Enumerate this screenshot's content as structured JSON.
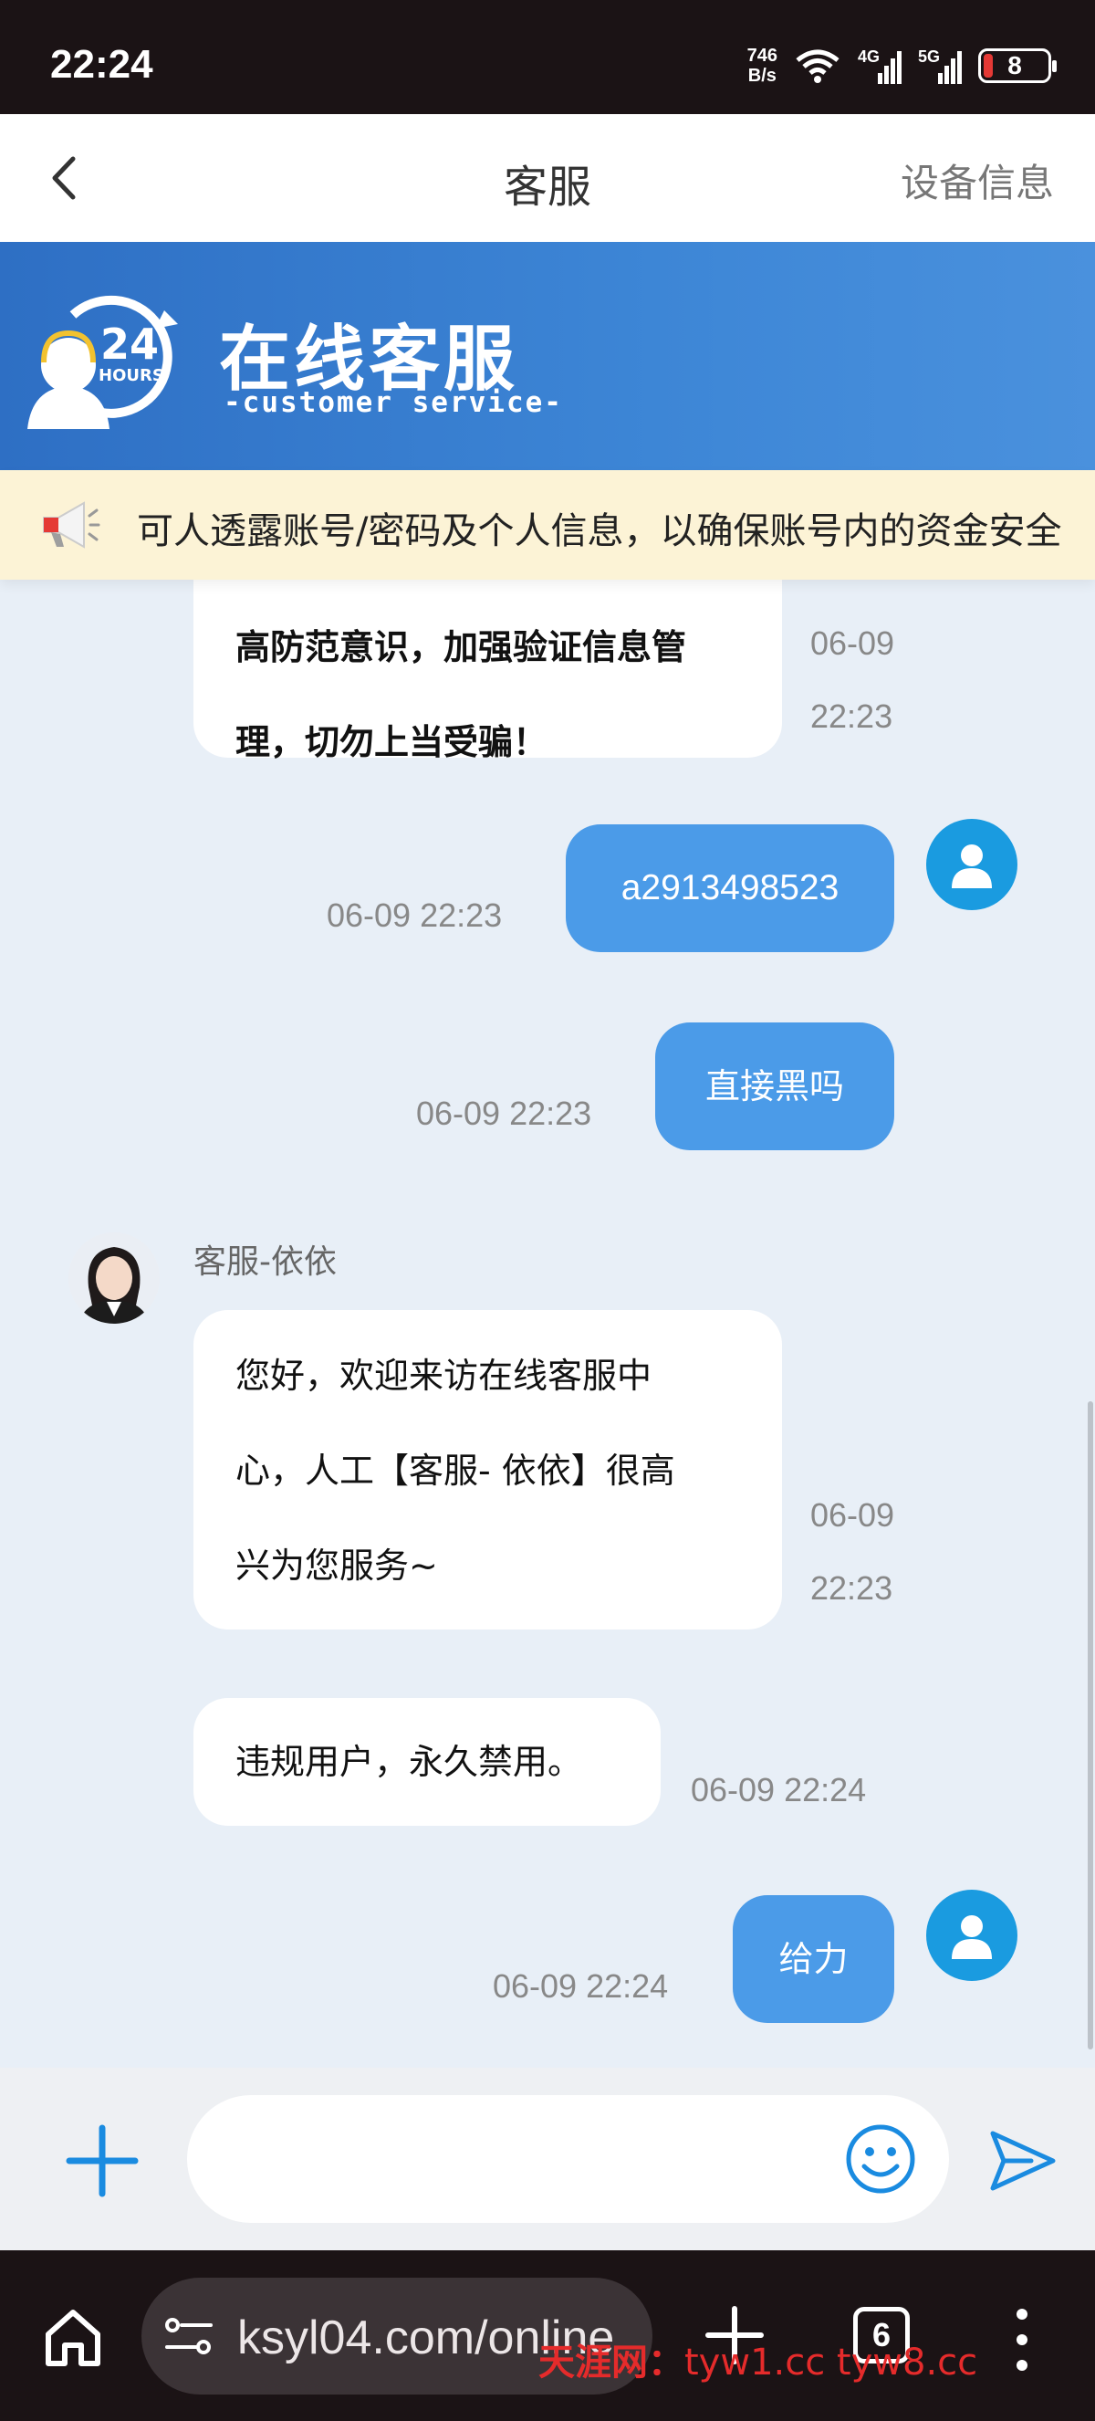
{
  "status_bar": {
    "time": "22:24",
    "net_speed_value": "746",
    "net_speed_unit": "B/s",
    "signal_1_tag": "4G",
    "signal_2_tag": "5G",
    "battery": "8"
  },
  "nav": {
    "title": "客服",
    "right_link": "设备信息"
  },
  "banner": {
    "logo_number": "24",
    "logo_hours": "HOURS",
    "title": "在线客服",
    "subtitle": "-customer service-"
  },
  "notice": {
    "text": "可人透露账号/密码及个人信息，以确保账号内的资金安全"
  },
  "messages": [
    {
      "line1": "高防范意识，加强验证信息管",
      "line2": "理，切勿上当受骗！",
      "date": "06-09",
      "time": "22:23"
    },
    {
      "text": "a2913498523",
      "timestamp": "06-09 22:23"
    },
    {
      "text": "直接黑吗",
      "timestamp": "06-09 22:23"
    },
    {
      "sender": "客服-依依",
      "line1": "您好，欢迎来访在线客服中",
      "line2": "心，人工【客服- 依依】很高",
      "line3": "兴为您服务~",
      "date": "06-09",
      "time": "22:23"
    },
    {
      "text": "违规用户，永久禁用。",
      "timestamp": "06-09 22:24"
    },
    {
      "text": "给力",
      "timestamp": "06-09 22:24"
    }
  ],
  "input": {
    "placeholder": ""
  },
  "browser": {
    "url": "ksyl04.com/online",
    "tab_count": "6"
  },
  "watermark": {
    "label": "天涯网：",
    "sites": "tyw1.cc  tyw8.cc"
  },
  "colors": {
    "bubble_out": "#4b9be8",
    "avatar_user": "#1a9be0",
    "banner": "#3d86d6",
    "notice_bg": "#fcf3d6"
  }
}
